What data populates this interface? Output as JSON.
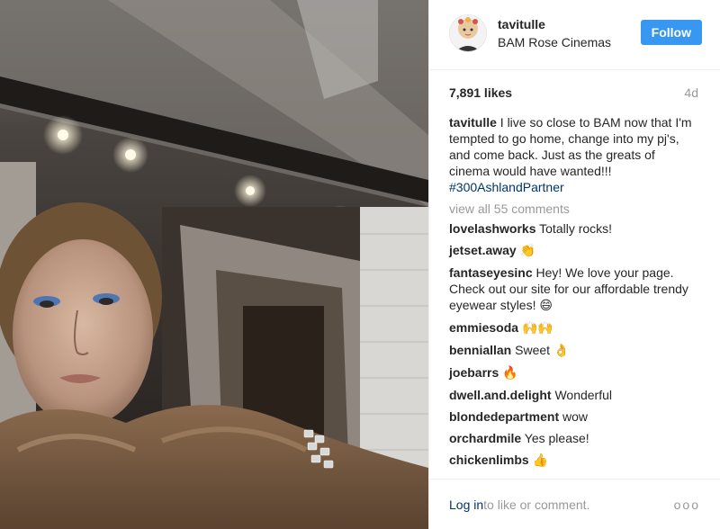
{
  "post": {
    "username": "tavitulle",
    "location": "BAM Rose Cinemas",
    "follow_label": "Follow",
    "likes": "7,891 likes",
    "age": "4d",
    "caption": {
      "user": "tavitulle",
      "text": "I live so close to BAM now that I'm tempted to go home, change into my pj's, and come back. Just as the greats of cinema would have wanted!!!",
      "hashtag": "#300AshlandPartner"
    },
    "view_all": "view all 55 comments",
    "comments": [
      {
        "user": "lovelashworks",
        "text": "Totally rocks!",
        "emoji": ""
      },
      {
        "user": "jetset.away",
        "text": "",
        "emoji": "👏"
      },
      {
        "user": "fantaseyesinc",
        "text": "Hey! We love your page. Check out our site for our affordable trendy eyewear styles!",
        "emoji": "😄"
      },
      {
        "user": "emmiesoda",
        "text": "",
        "emoji": "🙌🙌"
      },
      {
        "user": "benniallan",
        "text": "Sweet",
        "emoji": "👌"
      },
      {
        "user": "joebarrs",
        "text": "",
        "emoji": "🔥"
      },
      {
        "user": "dwell.and.delight",
        "text": "Wonderful",
        "emoji": ""
      },
      {
        "user": "blondedepartment",
        "text": "wow",
        "emoji": ""
      },
      {
        "user": "orchardmile",
        "text": "Yes please!",
        "emoji": ""
      },
      {
        "user": "chickenlimbs",
        "text": "",
        "emoji": "👍"
      }
    ],
    "footer": {
      "login": "Log in",
      "rest": " to like or comment.",
      "more": "ooo"
    }
  },
  "icons": {
    "avatar": "profile-avatar",
    "more": "more-options-icon"
  },
  "colors": {
    "follow": "#3897f0",
    "link": "#003569",
    "muted": "#999999"
  }
}
